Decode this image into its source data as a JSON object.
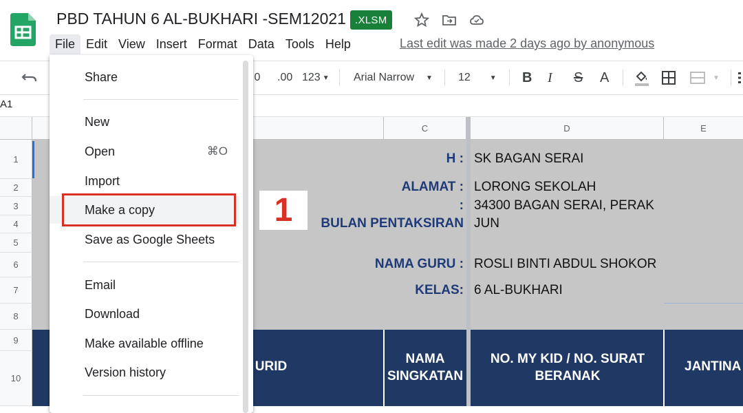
{
  "window": {
    "title": "PBD TAHUN 6 AL-BUKHARI -SEM12021",
    "badge": ".XLSM",
    "last_edit": "Last edit was made 2 days ago by anonymous"
  },
  "menu": [
    "File",
    "Edit",
    "View",
    "Insert",
    "Format",
    "Data",
    "Tools",
    "Help"
  ],
  "toolbar": {
    "decimal_decrease": ".0",
    "decimal_increase": ".00",
    "number_format": "123",
    "font": "Arial Narrow",
    "font_size": "12",
    "bold": "B",
    "italic": "I",
    "strike": "S",
    "text_color": "A",
    "icons": [
      "undo-icon",
      "fill-color-icon",
      "borders-icon",
      "merge-cells-icon"
    ]
  },
  "name_box": "A1",
  "columns": [
    "C",
    "D",
    "E"
  ],
  "rows": [
    "1",
    "2",
    "3",
    "4",
    "5",
    "6",
    "7",
    "8",
    "9",
    "10"
  ],
  "sheet": {
    "fields": [
      {
        "label": "H :",
        "value": "SK  BAGAN  SERAI"
      },
      {
        "label": "ALAMAT :",
        "value": "LORONG  SEKOLAH"
      },
      {
        "label": ":",
        "value": "34300  BAGAN  SERAI, PERAK"
      },
      {
        "label": "BULAN PENTAKSIRAN",
        "value": "JUN"
      },
      {
        "label": "NAMA GURU :",
        "value": "ROSLI  BINTI ABDUL SHOKOR"
      },
      {
        "label": "KELAS:",
        "value": "6  AL-BUKHARI"
      }
    ],
    "headers": [
      "URID",
      "NAMA SINGKATAN",
      "NO. MY KID / NO. SURAT BERANAK",
      "JANTINA"
    ]
  },
  "annotation": "1",
  "file_menu": {
    "items": [
      "Share",
      "New",
      "Open",
      "Import",
      "Make a copy",
      "Save as Google Sheets",
      "Email",
      "Download",
      "Make available offline",
      "Version history"
    ],
    "open_shortcut": "⌘O",
    "highlighted": "Make a copy"
  },
  "colors": {
    "header_navy": "#1f3864",
    "label_blue": "#1f3a78",
    "sheet_grey": "#c6c6c6",
    "highlight_red": "#d93025",
    "badge_green": "#188038"
  }
}
